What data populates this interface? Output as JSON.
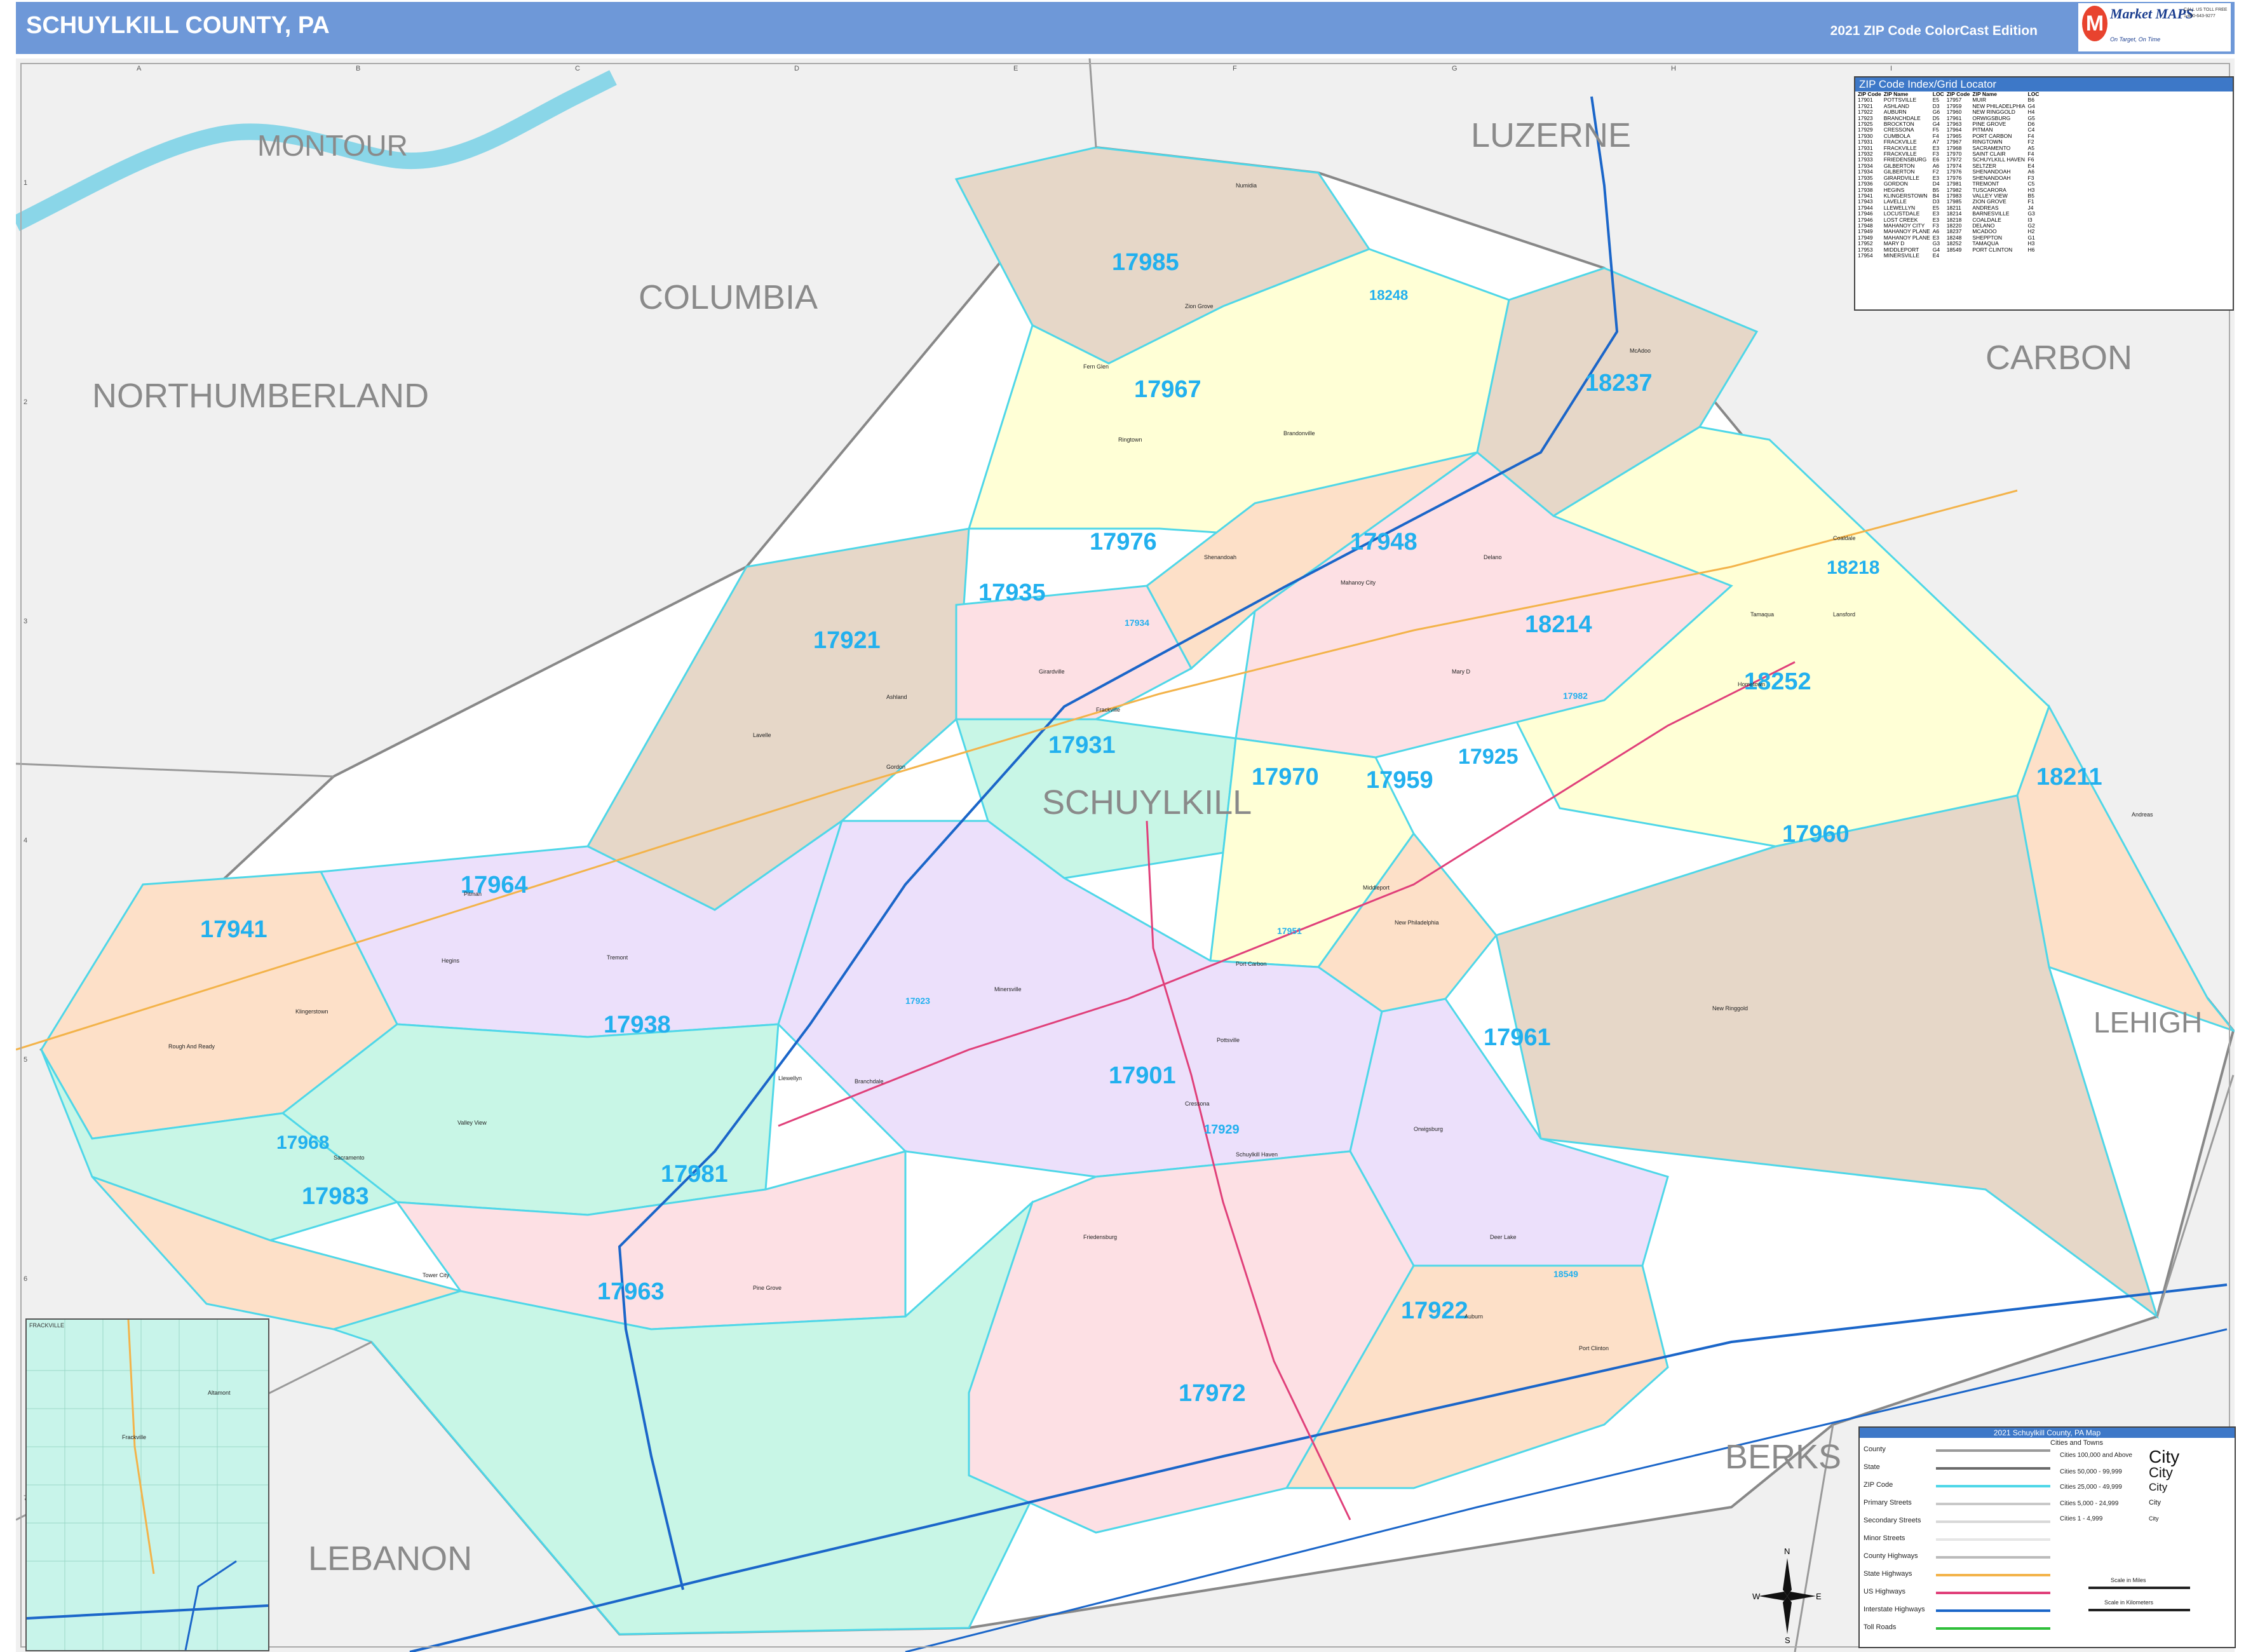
{
  "header": {
    "title": "SCHUYLKILL COUNTY, PA",
    "edition": "2021 ZIP Code ColorCast Edition"
  },
  "logo": {
    "name": "Market MAPS",
    "tagline": "On Target, On Time",
    "sub": "America's Leading Source of Business Maps",
    "phone_label": "CALL US TOLL FREE",
    "phone": "1-800-643-9277"
  },
  "grid": {
    "columns": [
      "A",
      "B",
      "C",
      "D",
      "E",
      "F",
      "G",
      "H",
      "I"
    ],
    "rows": [
      "1",
      "2",
      "3",
      "4",
      "5",
      "6",
      "7"
    ]
  },
  "counties": [
    "MONTOUR",
    "LUZERNE",
    "COLUMBIA",
    "CARBON",
    "NORTHUMBERLAND",
    "SCHUYLKILL",
    "LEHIGH",
    "BERKS",
    "LEBANON"
  ],
  "zips": [
    "17985",
    "18248",
    "17967",
    "18237",
    "17976",
    "17948",
    "18218",
    "17935",
    "17921",
    "17934",
    "18214",
    "18252",
    "17931",
    "17982",
    "17925",
    "17970",
    "17959",
    "18211",
    "17960",
    "17964",
    "17941",
    "17938",
    "17901",
    "17961",
    "17923",
    "17929",
    "17968",
    "17981",
    "17983",
    "17963",
    "17922",
    "18549",
    "17972",
    "17951"
  ],
  "towns": [
    "Numidia",
    "Zion Grove",
    "Fern Glen",
    "Ringtown",
    "Brandonville",
    "Mahanoy City",
    "Shenandoah",
    "Frackville",
    "Girardville",
    "Ashland",
    "Gordon",
    "Lavelle",
    "Pitman",
    "Tremont",
    "Pine Grove",
    "Tower City",
    "Minersville",
    "Pottsville",
    "Schuylkill Haven",
    "Tamaqua",
    "Coaldale",
    "Lansford",
    "Port Carbon",
    "Cressona",
    "Orwigsburg",
    "Auburn",
    "Deer Lake",
    "New Ringgold",
    "Andreas",
    "Port Clinton",
    "Friedensburg",
    "Hegins",
    "Valley View",
    "McAdoo",
    "New Philadelphia",
    "Middleport",
    "Delano",
    "Hometown",
    "Mary D",
    "Llewellyn",
    "Branchdale",
    "Sacramento",
    "Klingerstown",
    "Rough And Ready"
  ],
  "index": {
    "title": "ZIP Code Index/Grid Locator",
    "columns": [
      "ZIP Code",
      "ZIP Name",
      "LOC",
      "ZIP Code",
      "ZIP Name",
      "LOC"
    ],
    "rows": [
      [
        "17901",
        "POTTSVILLE",
        "E5",
        "17957",
        "MUIR",
        "B6"
      ],
      [
        "17921",
        "ASHLAND",
        "D3",
        "17959",
        "NEW PHILADELPHIA",
        "G4"
      ],
      [
        "17922",
        "AUBURN",
        "G6",
        "17960",
        "NEW RINGGOLD",
        "H4"
      ],
      [
        "17923",
        "BRANCHDALE",
        "D5",
        "17961",
        "ORWIGSBURG",
        "G5"
      ],
      [
        "17925",
        "BROCKTON",
        "G4",
        "17963",
        "PINE GROVE",
        "D6"
      ],
      [
        "17929",
        "CRESSONA",
        "F5",
        "17964",
        "PITMAN",
        "C4"
      ],
      [
        "17930",
        "CUMBOLA",
        "F4",
        "17965",
        "PORT CARBON",
        "F4"
      ],
      [
        "17931",
        "FRACKVILLE",
        "A7",
        "17967",
        "RINGTOWN",
        "F2"
      ],
      [
        "17931",
        "FRACKVILLE",
        "E3",
        "17968",
        "SACRAMENTO",
        "A5"
      ],
      [
        "17932",
        "FRACKVILLE",
        "F3",
        "17970",
        "SAINT CLAIR",
        "F4"
      ],
      [
        "17933",
        "FRIEDENSBURG",
        "E6",
        "17972",
        "SCHUYLKILL HAVEN",
        "F6"
      ],
      [
        "17934",
        "GILBERTON",
        "A6",
        "17974",
        "SELTZER",
        "E4"
      ],
      [
        "17934",
        "GILBERTON",
        "F2",
        "17976",
        "SHENANDOAH",
        "A6"
      ],
      [
        "17935",
        "GIRARDVILLE",
        "E3",
        "17976",
        "SHENANDOAH",
        "F3"
      ],
      [
        "17936",
        "GORDON",
        "D4",
        "17981",
        "TREMONT",
        "C5"
      ],
      [
        "17938",
        "HEGINS",
        "B5",
        "17982",
        "TUSCARORA",
        "H3"
      ],
      [
        "17941",
        "KLINGERSTOWN",
        "B4",
        "17983",
        "VALLEY VIEW",
        "B5"
      ],
      [
        "17943",
        "LAVELLE",
        "D3",
        "17985",
        "ZION GROVE",
        "F1"
      ],
      [
        "17944",
        "LLEWELLYN",
        "E5",
        "18211",
        "ANDREAS",
        "J4"
      ],
      [
        "17946",
        "LOCUSTDALE",
        "E3",
        "18214",
        "BARNESVILLE",
        "G3"
      ],
      [
        "17946",
        "LOST CREEK",
        "E3",
        "18218",
        "COALDALE",
        "I3"
      ],
      [
        "17948",
        "MAHANOY CITY",
        "F3",
        "18220",
        "DELANO",
        "G2"
      ],
      [
        "17949",
        "MAHANOY PLANE",
        "A6",
        "18237",
        "MCADOO",
        "H2"
      ],
      [
        "17949",
        "MAHANOY PLANE",
        "E3",
        "18248",
        "SHEPPTON",
        "G1"
      ],
      [
        "17952",
        "MARY D",
        "G3",
        "18252",
        "TAMAQUA",
        "H3"
      ],
      [
        "17953",
        "MIDDLEPORT",
        "G4",
        "18549",
        "PORT CLINTON",
        "H6"
      ],
      [
        "17954",
        "MINERSVILLE",
        "E4",
        "",
        "",
        ""
      ]
    ]
  },
  "legend": {
    "title": "2021 Schuylkill County, PA Map",
    "items": [
      "County",
      "State",
      "ZIP Code",
      "Primary Streets",
      "Secondary Streets",
      "Minor Streets",
      "County Highways",
      "State Highways",
      "US Highways",
      "Interstate Highways",
      "Toll Roads"
    ],
    "colors": [
      "#9a9a9a",
      "#6a6a6a",
      "#4fd7e8",
      "#c8c8c8",
      "#d8d8d8",
      "#e6e6e6",
      "#bbbbbb",
      "#f3b34a",
      "#e0407a",
      "#1b66c9",
      "#2fbf3a"
    ],
    "cities_title": "Cities and Towns",
    "cities": [
      "Cities 100,000 and Above",
      "Cities 50,000 - 99,999",
      "Cities 25,000 - 49,999",
      "Cities 5,000 - 24,999",
      "Cities 1 - 4,999"
    ],
    "city_samples": [
      "City",
      "City",
      "City",
      "City",
      "City"
    ],
    "scale_miles": "Scale in Miles",
    "scale_km": "Scale in Kilometers"
  },
  "inset": {
    "title": "FRACKVILLE",
    "towns": [
      "Altamont",
      "Frackville"
    ]
  },
  "compass": {
    "n": "N",
    "s": "S",
    "e": "E",
    "w": "W"
  }
}
